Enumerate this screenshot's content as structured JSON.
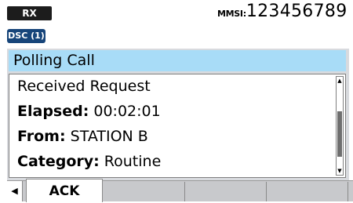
{
  "status_bar": {
    "rx_label": "RX",
    "mmsi_label": "MMSI:",
    "mmsi_value": "123456789"
  },
  "dsc_badge": "DSC (1)",
  "panel": {
    "title": "Polling Call",
    "lines": [
      {
        "label": "",
        "value": "Received Request"
      },
      {
        "label": "Elapsed:",
        "value": "00:02:01"
      },
      {
        "label": "From:",
        "value": "STATION B"
      },
      {
        "label": "Category:",
        "value": "Routine"
      }
    ]
  },
  "softkeys": {
    "left_arrow": "◀",
    "ack_label": "ACK"
  },
  "scrollbar": {
    "up_arrow": "▲",
    "down_arrow": "▼"
  }
}
